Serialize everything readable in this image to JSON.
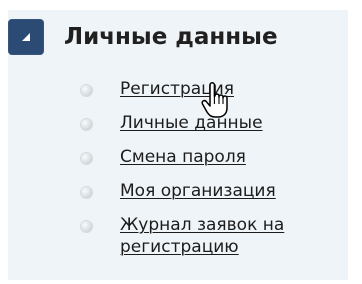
{
  "section": {
    "title": "Личные данные",
    "toggle_icon": "collapse-arrow-icon"
  },
  "menu": {
    "items": [
      {
        "label": "Регистрация",
        "icon": "bullet-icon"
      },
      {
        "label": "Личные данные",
        "icon": "bullet-icon"
      },
      {
        "label": "Смена пароля",
        "icon": "bullet-icon"
      },
      {
        "label": "Моя организация",
        "icon": "bullet-icon"
      },
      {
        "label": "Журнал заявок на регистрацию",
        "icon": "bullet-icon"
      }
    ]
  },
  "colors": {
    "panel_background": "#eef4f8",
    "toggle_background": "#2b4a74",
    "text": "#1c1c1c"
  },
  "cursor": {
    "icon": "hand-pointer-icon"
  }
}
